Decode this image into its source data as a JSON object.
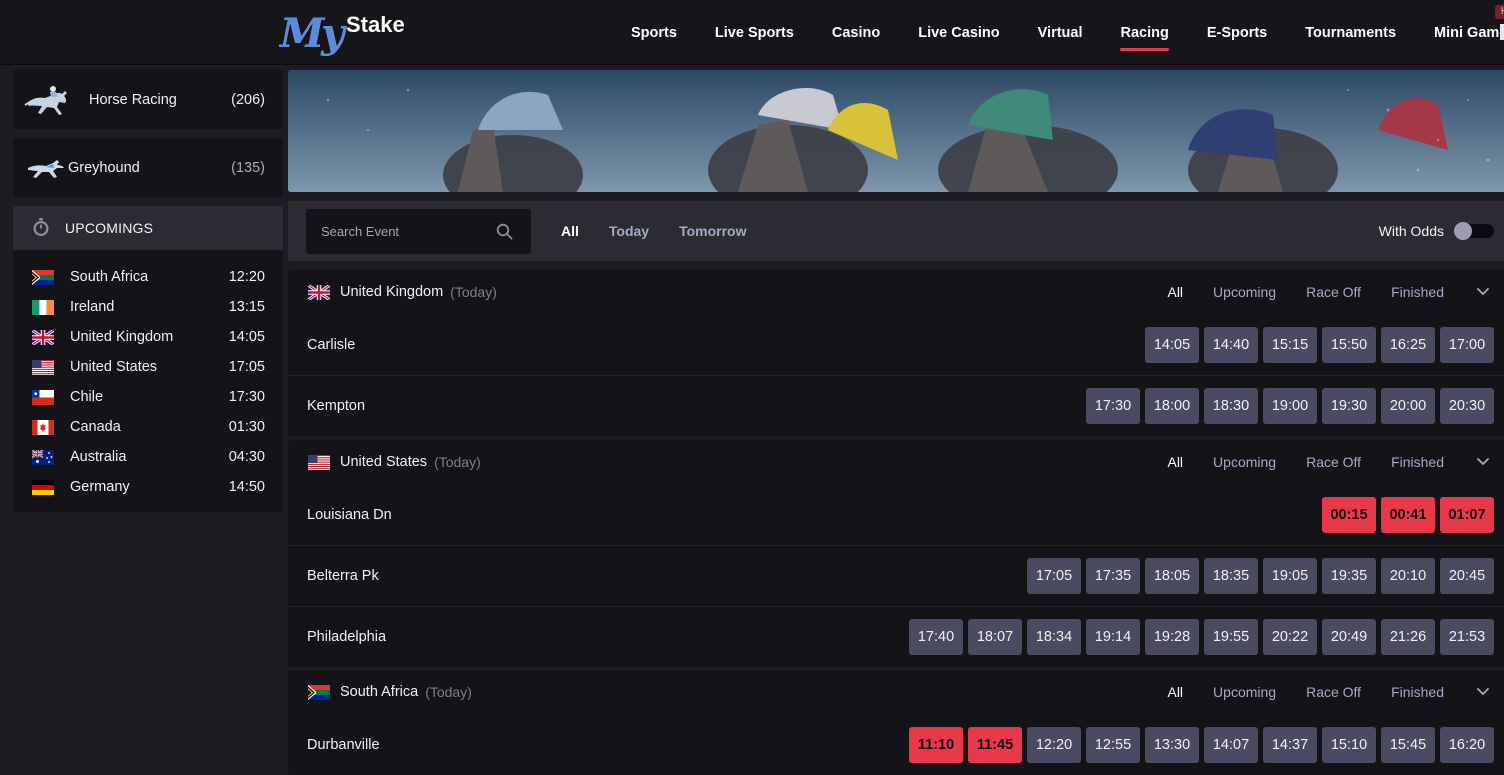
{
  "brand": {
    "logo_my": "My",
    "logo_stake": "Stake"
  },
  "nav": {
    "items": [
      {
        "label": "Sports",
        "active": false
      },
      {
        "label": "Live Sports",
        "active": false
      },
      {
        "label": "Casino",
        "active": false
      },
      {
        "label": "Live Casino",
        "active": false
      },
      {
        "label": "Virtual",
        "active": false
      },
      {
        "label": "Racing",
        "active": true
      },
      {
        "label": "E-Sports",
        "active": false
      },
      {
        "label": "Tournaments",
        "active": false
      },
      {
        "label": "Mini Games",
        "active": false,
        "badge": "Hot"
      }
    ]
  },
  "sidebar": {
    "sports": [
      {
        "label": "Horse Racing",
        "count": "(206)",
        "icon": "horse-icon"
      },
      {
        "label": "Greyhound",
        "count": "(135)",
        "icon": "greyhound-icon"
      }
    ],
    "upcomings": {
      "title": "UPCOMINGS",
      "icon": "stopwatch-icon",
      "items": [
        {
          "country": "South Africa",
          "time": "12:20",
          "flag": "za"
        },
        {
          "country": "Ireland",
          "time": "13:15",
          "flag": "ie"
        },
        {
          "country": "United Kingdom",
          "time": "14:05",
          "flag": "gb"
        },
        {
          "country": "United States",
          "time": "17:05",
          "flag": "us"
        },
        {
          "country": "Chile",
          "time": "17:30",
          "flag": "cl"
        },
        {
          "country": "Canada",
          "time": "01:30",
          "flag": "ca"
        },
        {
          "country": "Australia",
          "time": "04:30",
          "flag": "au"
        },
        {
          "country": "Germany",
          "time": "14:50",
          "flag": "de"
        }
      ]
    }
  },
  "filter": {
    "search_placeholder": "Search Event",
    "tabs": [
      {
        "label": "All",
        "active": true
      },
      {
        "label": "Today",
        "active": false
      },
      {
        "label": "Tomorrow",
        "active": false
      }
    ],
    "odds_label": "With Odds",
    "odds_on": false
  },
  "section_tabs": [
    "All",
    "Upcoming",
    "Race Off",
    "Finished"
  ],
  "sections": [
    {
      "country": "United Kingdom",
      "day": "(Today)",
      "flag": "gb",
      "tracks": [
        {
          "name": "Carlisle",
          "live": [],
          "races": [
            "14:05",
            "14:40",
            "15:15",
            "15:50",
            "16:25",
            "17:00"
          ]
        },
        {
          "name": "Kempton",
          "live": [],
          "races": [
            "17:30",
            "18:00",
            "18:30",
            "19:00",
            "19:30",
            "20:00",
            "20:30"
          ]
        }
      ]
    },
    {
      "country": "United States",
      "day": "(Today)",
      "flag": "us",
      "tracks": [
        {
          "name": "Louisiana Dn",
          "live": [
            "00:15",
            "00:41",
            "01:07"
          ],
          "races": []
        },
        {
          "name": "Belterra Pk",
          "live": [],
          "races": [
            "17:05",
            "17:35",
            "18:05",
            "18:35",
            "19:05",
            "19:35",
            "20:10",
            "20:45"
          ]
        },
        {
          "name": "Philadelphia",
          "live": [],
          "races": [
            "17:40",
            "18:07",
            "18:34",
            "19:14",
            "19:28",
            "19:55",
            "20:22",
            "20:49",
            "21:26",
            "21:53"
          ]
        }
      ]
    },
    {
      "country": "South Africa",
      "day": "(Today)",
      "flag": "za",
      "tracks": [
        {
          "name": "Durbanville",
          "live": [
            "11:10",
            "11:45"
          ],
          "races": [
            "12:20",
            "12:55",
            "13:30",
            "14:07",
            "14:37",
            "15:10",
            "15:45",
            "16:20"
          ]
        }
      ]
    }
  ],
  "colors": {
    "accent": "#e8394a",
    "race_button": "#4a4a60",
    "panel": "#131318",
    "bar": "#2b2b34"
  }
}
